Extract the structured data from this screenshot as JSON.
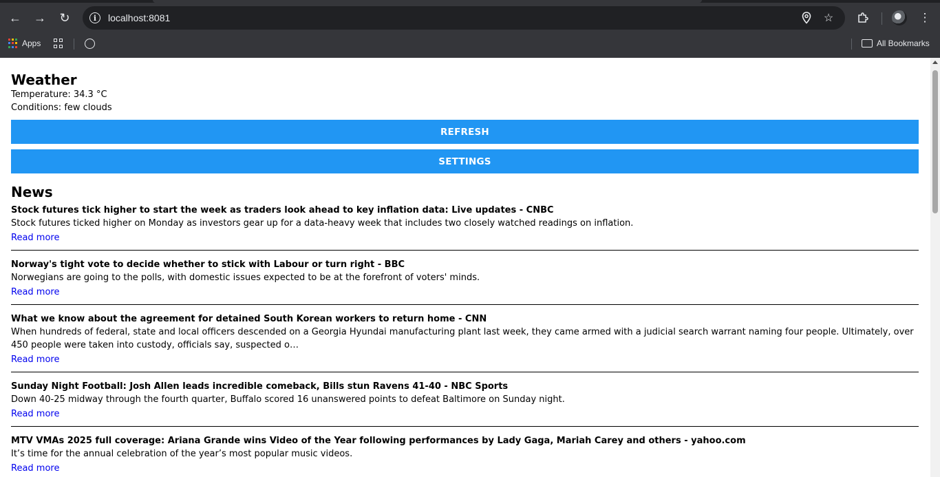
{
  "browser": {
    "url": "localhost:8081",
    "bookmarks": {
      "apps_label": "Apps",
      "all_bookmarks_label": "All Bookmarks"
    }
  },
  "weather": {
    "heading": "Weather",
    "temperature": "Temperature: 34.3 °C",
    "conditions": "Conditions: few clouds",
    "refresh_label": "REFRESH",
    "settings_label": "SETTINGS"
  },
  "news": {
    "heading": "News",
    "read_more_label": "Read more",
    "items": [
      {
        "title": "Stock futures tick higher to start the week as traders look ahead to key inflation data: Live updates - CNBC",
        "description": "Stock futures ticked higher on Monday as investors gear up for a data-heavy week that includes two closely watched readings on inflation."
      },
      {
        "title": "Norway's tight vote to decide whether to stick with Labour or turn right - BBC",
        "description": "Norwegians are going to the polls, with domestic issues expected to be at the forefront of voters' minds."
      },
      {
        "title": "What we know about the agreement for detained South Korean workers to return home - CNN",
        "description": "When hundreds of federal, state and local officers descended on a Georgia Hyundai manufacturing plant last week, they came armed with a judicial search warrant naming four people. Ultimately, over 450 people were taken into custody, officials say, suspected o…"
      },
      {
        "title": "Sunday Night Football: Josh Allen leads incredible comeback, Bills stun Ravens 41-40 - NBC Sports",
        "description": "Down 40-25 midway through the fourth quarter, Buffalo scored 16 unanswered points to defeat Baltimore on Sunday night."
      },
      {
        "title": "MTV VMAs 2025 full coverage: Ariana Grande wins Video of the Year following performances by Lady Gaga, Mariah Carey and others - yahoo.com",
        "description": "It’s time for the annual celebration of the year’s most popular music videos."
      }
    ]
  },
  "colors": {
    "button_bg": "#2196f3",
    "link": "#0000ee",
    "chrome_bg": "#35363a"
  }
}
